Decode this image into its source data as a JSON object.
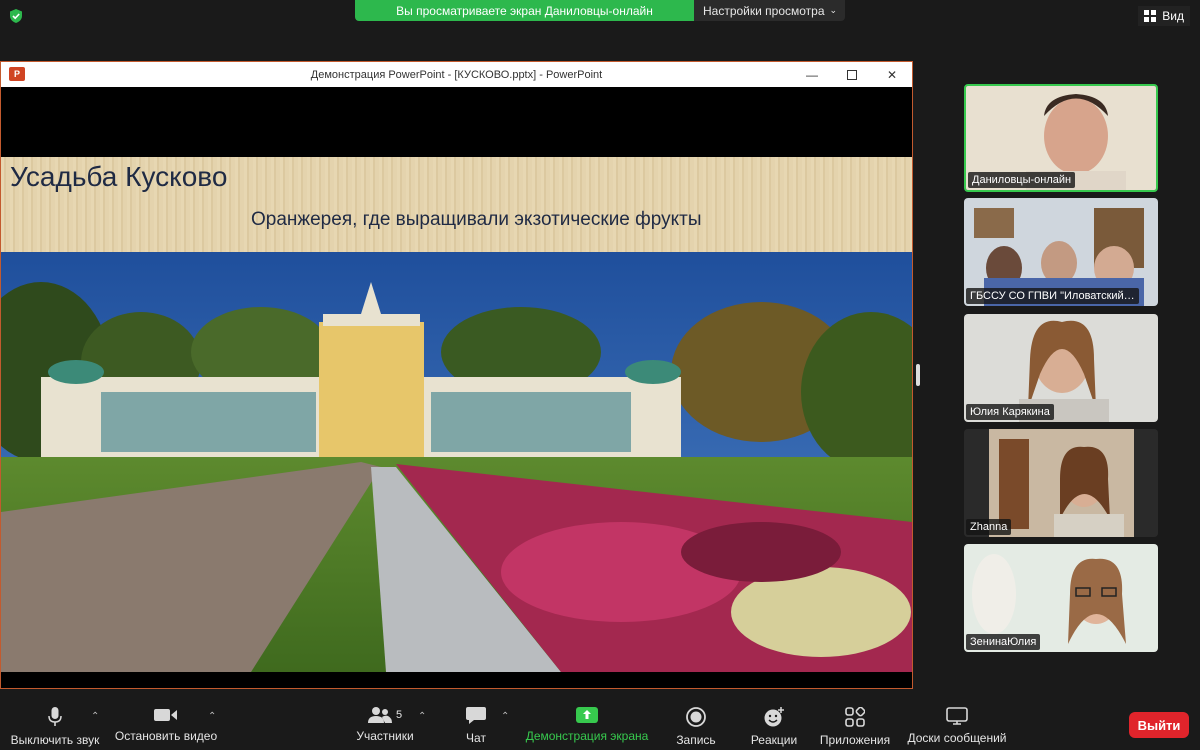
{
  "top": {
    "share_banner": "Вы просматриваете экран Даниловцы-онлайн",
    "view_settings": "Настройки просмотра",
    "view_button": "Вид"
  },
  "ppt": {
    "window_title": "Демонстрация PowerPoint - [КУСКОВО.pptx] - PowerPoint",
    "logo_letter": "P",
    "slide_title": "Усадьба Кусково",
    "slide_subtitle": "Оранжерея, где выращивали экзотические фрукты"
  },
  "participants": [
    {
      "name": "Даниловцы-онлайн",
      "active": true
    },
    {
      "name": "ГБССУ СО ГПВИ \"Иловатский…",
      "active": false
    },
    {
      "name": "Юлия Карякина",
      "active": false
    },
    {
      "name": "Zhanna",
      "active": false
    },
    {
      "name": "ЗенинаЮлия",
      "active": false
    }
  ],
  "toolbar": {
    "mute": "Выключить звук",
    "stop_video": "Остановить видео",
    "participants": "Участники",
    "participants_count": "5",
    "chat": "Чат",
    "share": "Демонстрация экрана",
    "record": "Запись",
    "reactions": "Реакции",
    "apps": "Приложения",
    "whiteboards": "Доски сообщений",
    "leave": "Выйти"
  },
  "colors": {
    "green": "#2db84d",
    "leave_red": "#e0242b",
    "active_border": "#37c94e"
  }
}
